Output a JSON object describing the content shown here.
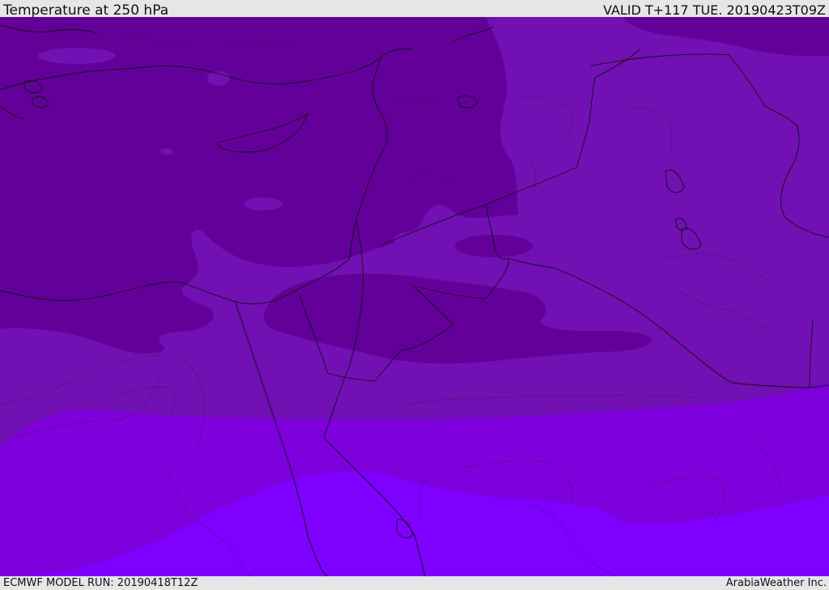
{
  "header": {
    "title": "Temperature at 250 hPa",
    "valid": "VALID T+117 TUE. 20190423T09Z"
  },
  "footer": {
    "model_run": "ECMWF MODEL RUN: 20190418T12Z",
    "credit": "ArabiaWeather Inc."
  },
  "map": {
    "field": "temperature",
    "level": "250 hPa",
    "fill_colors": {
      "coldest": "#63009a",
      "cold": "#7110b3",
      "mid": "#7d00dd",
      "warm": "#7e00ff"
    },
    "line_color": "#111111"
  }
}
